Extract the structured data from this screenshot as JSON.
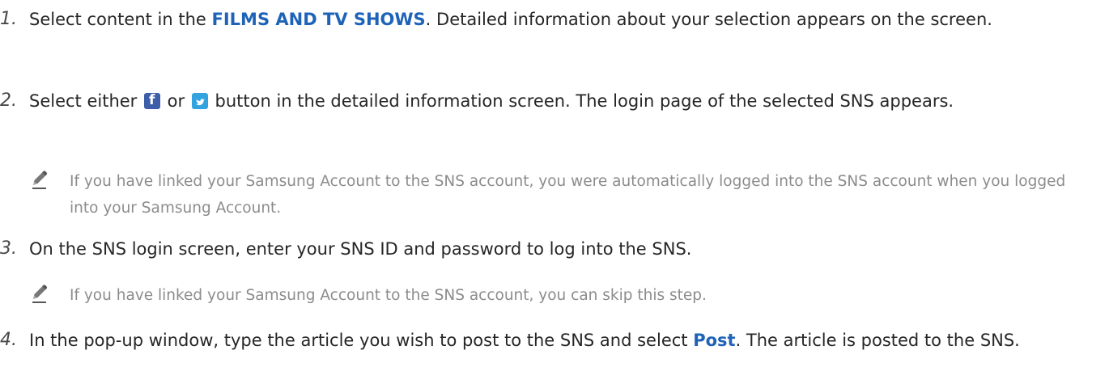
{
  "steps": [
    {
      "num": "1.",
      "pre": "Select content in the ",
      "highlight": "FILMS AND TV SHOWS",
      "post": ". Detailed information about your selection appears on the screen."
    },
    {
      "num": "2.",
      "pre": "Select either ",
      "icon1": "facebook-icon",
      "mid": " or ",
      "icon2": "twitter-icon",
      "post": " button in the detailed information screen. The login page of the selected SNS appears."
    },
    {
      "num": "3.",
      "text": "On the SNS login screen, enter your SNS ID and password to log into the SNS."
    },
    {
      "num": "4.",
      "pre": "In the pop-up window, type the article you wish to post to the SNS and select ",
      "highlight": "Post",
      "post": ". The article is posted to the SNS."
    }
  ],
  "notes": [
    {
      "icon": "pencil-note-icon",
      "text": "If you have linked your Samsung Account to the SNS account, you were automatically logged into the SNS account when you logged into your Samsung Account."
    },
    {
      "icon": "pencil-note-icon",
      "text": "If you have linked your Samsung Account to the SNS account, you can skip this step."
    }
  ],
  "colors": {
    "highlight": "#1f63b8",
    "note_text": "#8c8c8c",
    "facebook": "#3d5ea8",
    "twitter": "#33a3e0"
  }
}
